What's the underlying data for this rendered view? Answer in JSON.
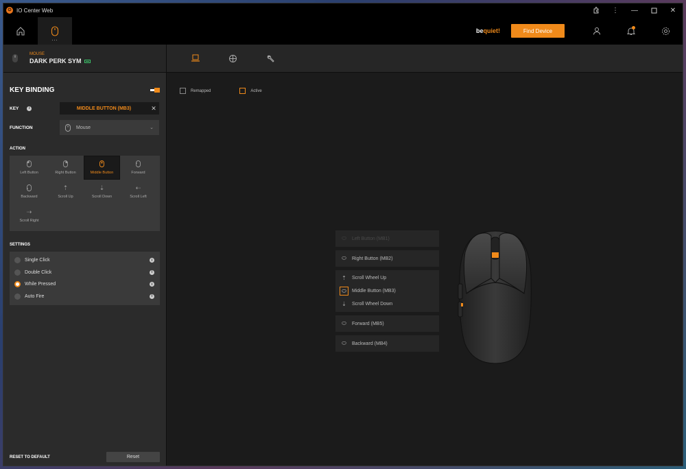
{
  "window": {
    "title": "IO Center Web"
  },
  "topnav": {
    "brand_prefix": "be ",
    "brand_accent": "quiet!",
    "find_device_label": "Find Device",
    "active_dots": "..."
  },
  "device": {
    "category": "MOUSE",
    "name": "DARK PERK SYM"
  },
  "key_binding": {
    "title": "KEY BINDING",
    "key_label": "KEY",
    "key_value": "MIDDLE BUTTON (MB3)",
    "function_label": "FUNCTION",
    "function_value": "Mouse",
    "action_label": "ACTION",
    "actions": [
      {
        "label": "Left Button",
        "icon": "mouse-icon"
      },
      {
        "label": "Right Button",
        "icon": "mouse-icon"
      },
      {
        "label": "Middle Button",
        "icon": "mouse-icon",
        "selected": true
      },
      {
        "label": "Forward",
        "icon": "mouse-icon"
      },
      {
        "label": "Backward",
        "icon": "mouse-icon"
      },
      {
        "label": "Scroll Up",
        "icon": "scroll-up-icon"
      },
      {
        "label": "Scroll Down",
        "icon": "scroll-down-icon"
      },
      {
        "label": "Scroll Left",
        "icon": "scroll-left-icon"
      },
      {
        "label": "Scroll Right",
        "icon": "scroll-right-icon"
      }
    ],
    "settings_label": "SETTINGS",
    "settings": [
      {
        "label": "Single Click",
        "selected": false
      },
      {
        "label": "Double Click",
        "selected": false
      },
      {
        "label": "While Pressed",
        "selected": true
      },
      {
        "label": "Auto Fire",
        "selected": false
      }
    ],
    "reset_label": "RESET TO DEFAULT",
    "reset_button": "Reset"
  },
  "legend": {
    "remapped": "Remapped",
    "active": "Active"
  },
  "button_list": {
    "left": "Left Button (MB1)",
    "right": "Right Button (MB2)",
    "scroll_up": "Scroll Wheel Up",
    "middle": "Middle Button (MB3)",
    "scroll_down": "Scroll Wheel Down",
    "forward": "Forward (MB5)",
    "backward": "Backward (MB4)"
  },
  "colors": {
    "accent": "#f08a1a",
    "battery": "#3cc46a"
  }
}
